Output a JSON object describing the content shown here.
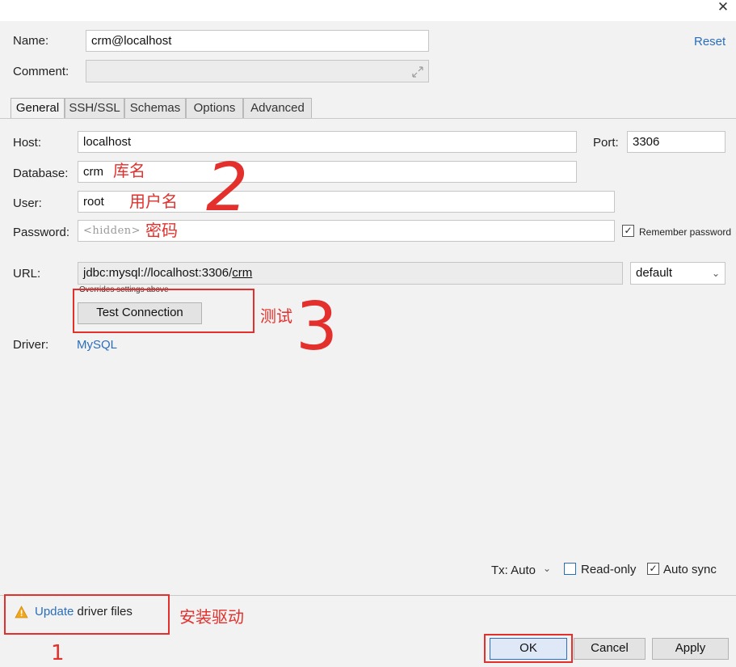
{
  "window": {
    "close_glyph": "✕"
  },
  "form": {
    "name_label": "Name:",
    "name_value": "crm@localhost",
    "reset_label": "Reset",
    "comment_label": "Comment:",
    "comment_value": ""
  },
  "tabs": [
    {
      "label": "General",
      "active": true
    },
    {
      "label": "SSH/SSL",
      "active": false
    },
    {
      "label": "Schemas",
      "active": false
    },
    {
      "label": "Options",
      "active": false
    },
    {
      "label": "Advanced",
      "active": false
    }
  ],
  "general": {
    "host_label": "Host:",
    "host_value": "localhost",
    "port_label": "Port:",
    "port_value": "3306",
    "database_label": "Database:",
    "database_value": "crm",
    "user_label": "User:",
    "user_value": "root",
    "password_label": "Password:",
    "password_placeholder": "<hidden>",
    "remember_password_label": "Remember password",
    "remember_password_checked": true,
    "url_label": "URL:",
    "url_prefix": "jdbc:mysql://localhost:3306/",
    "url_db": "crm",
    "url_mode": "default",
    "overrides_note": "Overrides settings above",
    "test_connection_label": "Test Connection",
    "driver_label": "Driver:",
    "driver_value": "MySQL"
  },
  "options_bar": {
    "tx_label": "Tx: Auto",
    "readonly_label": "Read-only",
    "readonly_checked": false,
    "autosync_label": "Auto sync",
    "autosync_checked": true
  },
  "footer": {
    "warning_icon": "warning-icon",
    "update_link": "Update",
    "update_rest": " driver files",
    "ok_label": "OK",
    "cancel_label": "Cancel",
    "apply_label": "Apply"
  },
  "annotations": {
    "database_note": "库名",
    "user_note": "用户名",
    "password_note": "密码",
    "test_note": "测试",
    "driver_note": "安装驱动",
    "step_1": "1",
    "step_2": "2",
    "step_3": "3"
  },
  "colors": {
    "link": "#2a6ebb",
    "annotation_red": "#e3302c",
    "dialog_bg": "#f2f2f2"
  }
}
